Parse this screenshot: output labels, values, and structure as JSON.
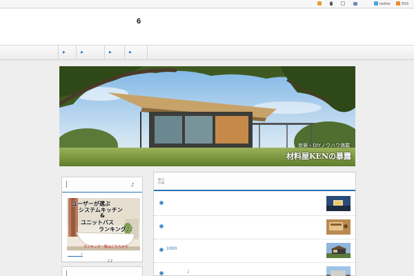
{
  "topbar": {
    "links": [
      {
        "icon": "edit-icon",
        "color": "#e0a030"
      },
      {
        "icon": "user-icon",
        "color": "#555555"
      },
      {
        "icon": "page-icon",
        "color": "#9aa7b5"
      },
      {
        "icon": "chart-icon",
        "color": "#6a8fb0"
      }
    ],
    "twitter_label": "twitter",
    "rss_label": "RSS",
    "twitter_color": "#4aa3df",
    "rss_color": "#f08a24"
  },
  "header": {
    "title": "6"
  },
  "nav": {
    "items": [
      {
        "arrow": "▶"
      },
      {
        "arrow": "▶"
      },
      {
        "arrow": "▶"
      },
      {
        "arrow": "▶"
      },
      {
        "arrow": "▶"
      }
    ]
  },
  "hero": {
    "caption_line1": "新築・DIYノウハウ満載",
    "caption_line2": "材料屋KENの暴露"
  },
  "sidebar": {
    "widget_title_note": "♪",
    "ad": {
      "line1": "ユーザーが選ぶ",
      "line2": "システムキッチン",
      "line3": "&",
      "line4": "ユニットバス",
      "line5": "ランキング♪♪",
      "red_text": "ランキング一覧はこちらから"
    },
    "ad_link": "♪",
    "ad_caption": "♪♪"
  },
  "main": {
    "posts": [
      {
        "title": ""
      },
      {
        "title": ""
      },
      {
        "title": "1000"
      },
      {
        "title": "♪"
      }
    ]
  },
  "colors": {
    "accent": "#2a6fb0",
    "background": "#eeeeee"
  }
}
